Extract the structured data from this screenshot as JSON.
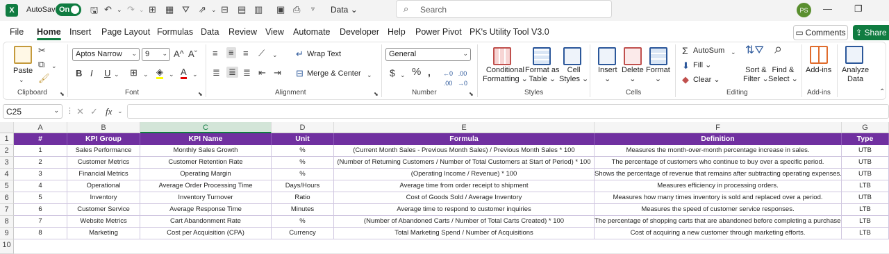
{
  "titlebar": {
    "autosave_label": "AutoSave",
    "autosave_state": "On",
    "doc_name": "Data",
    "search_placeholder": "Search",
    "user_initials": "PS"
  },
  "tabs": [
    "File",
    "Home",
    "Insert",
    "Page Layout",
    "Formulas",
    "Data",
    "Review",
    "View",
    "Automate",
    "Developer",
    "Help",
    "Power Pivot",
    "PK's Utility Tool V3.0"
  ],
  "active_tab": "Home",
  "comments_label": "Comments",
  "share_label": "Share",
  "ribbon": {
    "paste": "Paste",
    "clipboard": "Clipboard",
    "font_name": "Aptos Narrow",
    "font_size": "9",
    "font": "Font",
    "bold": "B",
    "italic": "I",
    "underline": "U",
    "wrap_text": "Wrap Text",
    "merge_center": "Merge & Center",
    "alignment": "Alignment",
    "number_format": "General",
    "number": "Number",
    "conditional": "Conditional",
    "formatting": "Formatting",
    "format_as": "Format as",
    "table": "Table",
    "cell": "Cell",
    "styles_btn": "Styles",
    "styles": "Styles",
    "insert": "Insert",
    "delete": "Delete",
    "format": "Format",
    "cells": "Cells",
    "autosum": "AutoSum",
    "fill": "Fill",
    "clear": "Clear",
    "sort": "Sort &",
    "filter": "Filter",
    "find": "Find &",
    "select": "Select",
    "editing": "Editing",
    "addins_btn": "Add-ins",
    "addins": "Add-ins",
    "analyze": "Analyze",
    "data": "Data"
  },
  "formula_bar": {
    "name_box": "C25",
    "fx": "fx",
    "formula": ""
  },
  "columns": [
    "A",
    "B",
    "C",
    "D",
    "E",
    "F",
    "G"
  ],
  "rows": [
    "1",
    "2",
    "3",
    "4",
    "5",
    "6",
    "7",
    "8",
    "9",
    "10"
  ],
  "table": {
    "headers": [
      "#",
      "KPI Group",
      "KPI Name",
      "Unit",
      "Formula",
      "Definition",
      "Type"
    ],
    "rows": [
      [
        "1",
        "Sales Performance",
        "Monthly Sales Growth",
        "%",
        "(Current Month Sales - Previous Month Sales) / Previous Month Sales * 100",
        "Measures the month-over-month percentage increase in sales.",
        "UTB"
      ],
      [
        "2",
        "Customer Metrics",
        "Customer Retention Rate",
        "%",
        "(Number of Returning Customers / Number of Total Customers at Start of Period) * 100",
        "The percentage of customers who continue to buy over a specific period.",
        "UTB"
      ],
      [
        "3",
        "Financial Metrics",
        "Operating Margin",
        "%",
        "(Operating Income / Revenue) * 100",
        "Shows the percentage of revenue that remains after subtracting operating expenses.",
        "UTB"
      ],
      [
        "4",
        "Operational",
        "Average Order Processing Time",
        "Days/Hours",
        "Average time from order receipt to shipment",
        "Measures efficiency in processing orders.",
        "LTB"
      ],
      [
        "5",
        "Inventory",
        "Inventory Turnover",
        "Ratio",
        "Cost of Goods Sold / Average Inventory",
        "Measures how many times inventory is sold and replaced over a period.",
        "UTB"
      ],
      [
        "6",
        "Customer Service",
        "Average Response Time",
        "Minutes",
        "Average time to respond to customer inquiries",
        "Measures the speed of customer service responses.",
        "LTB"
      ],
      [
        "7",
        "Website Metrics",
        "Cart Abandonment Rate",
        "%",
        "(Number of Abandoned Carts / Number of Total Carts Created) * 100",
        "The percentage of shopping carts that are abandoned before completing a purchase.",
        "LTB"
      ],
      [
        "8",
        "Marketing",
        "Cost per Acquisition (CPA)",
        "Currency",
        "Total Marketing Spend / Number of Acquisitions",
        "Cost of acquiring a new customer through marketing efforts.",
        "LTB"
      ]
    ]
  },
  "colors": {
    "excel_green": "#107c41",
    "header_purple": "#7030a0"
  }
}
